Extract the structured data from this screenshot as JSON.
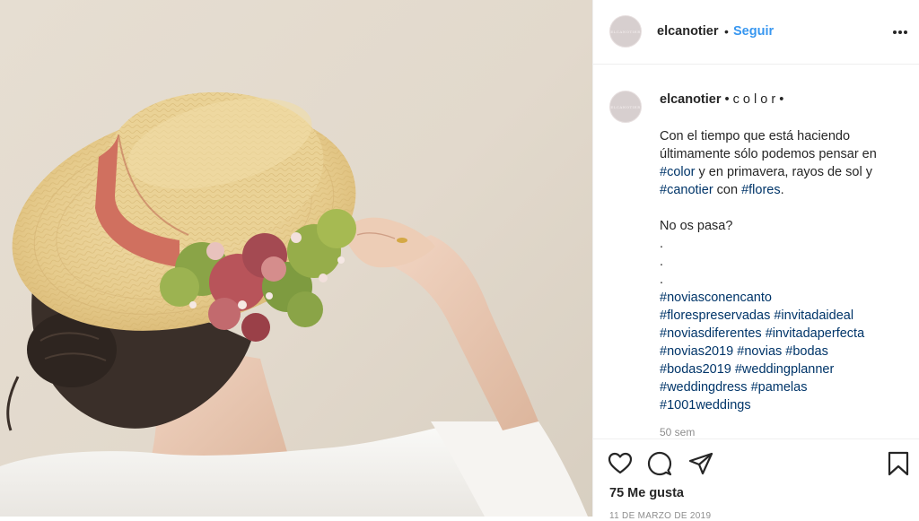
{
  "photo": {
    "subject": "woman-wearing-straw-boater-hat-with-flowers",
    "colors": {
      "wall": "#e2d9cc",
      "straw": "#e8cf93",
      "ribbon": "#d0705f",
      "hair": "#3a2f29",
      "shirt": "#f4f2ef",
      "hydrangea_green": "#8aa447",
      "hydrangea_red": "#b8545a"
    }
  },
  "header": {
    "avatar_text": "ELCANOTIER",
    "username": "elcanotier",
    "separator": "•",
    "follow_label": "Seguir",
    "more_icon": "more-horizontal-icon"
  },
  "caption": {
    "avatar_text": "ELCANOTIER",
    "username": "elcanotier",
    "title_suffix": "• c o l o r •",
    "line1": "Con el tiempo que está haciendo",
    "line2": "últimamente sólo podemos pensar en",
    "line3_tag": "#color",
    "line3_text": " y en primavera, rayos de sol y",
    "line4_tag1": "#canotier",
    "line4_text": " con ",
    "line4_tag2": "#flores",
    "line4_end": ".",
    "question": "No os pasa?",
    "dots": [
      ".",
      ".",
      "."
    ],
    "hashtag_lines": [
      [
        "#noviasconencanto"
      ],
      [
        "#florespreservadas",
        "#invitadaideal"
      ],
      [
        "#noviasdiferentes",
        "#invitadaperfecta"
      ],
      [
        "#novias2019",
        "#novias",
        "#bodas"
      ],
      [
        "#bodas2019",
        "#weddingplanner"
      ],
      [
        "#weddingdress",
        "#pamelas"
      ],
      [
        "#1001weddings"
      ]
    ],
    "time_ago": "50 sem"
  },
  "actions": {
    "like_icon": "heart-icon",
    "comment_icon": "comment-icon",
    "share_icon": "share-icon",
    "save_icon": "bookmark-icon",
    "likes_text": "75 Me gusta",
    "date_text": "11 DE MARZO DE 2019"
  }
}
